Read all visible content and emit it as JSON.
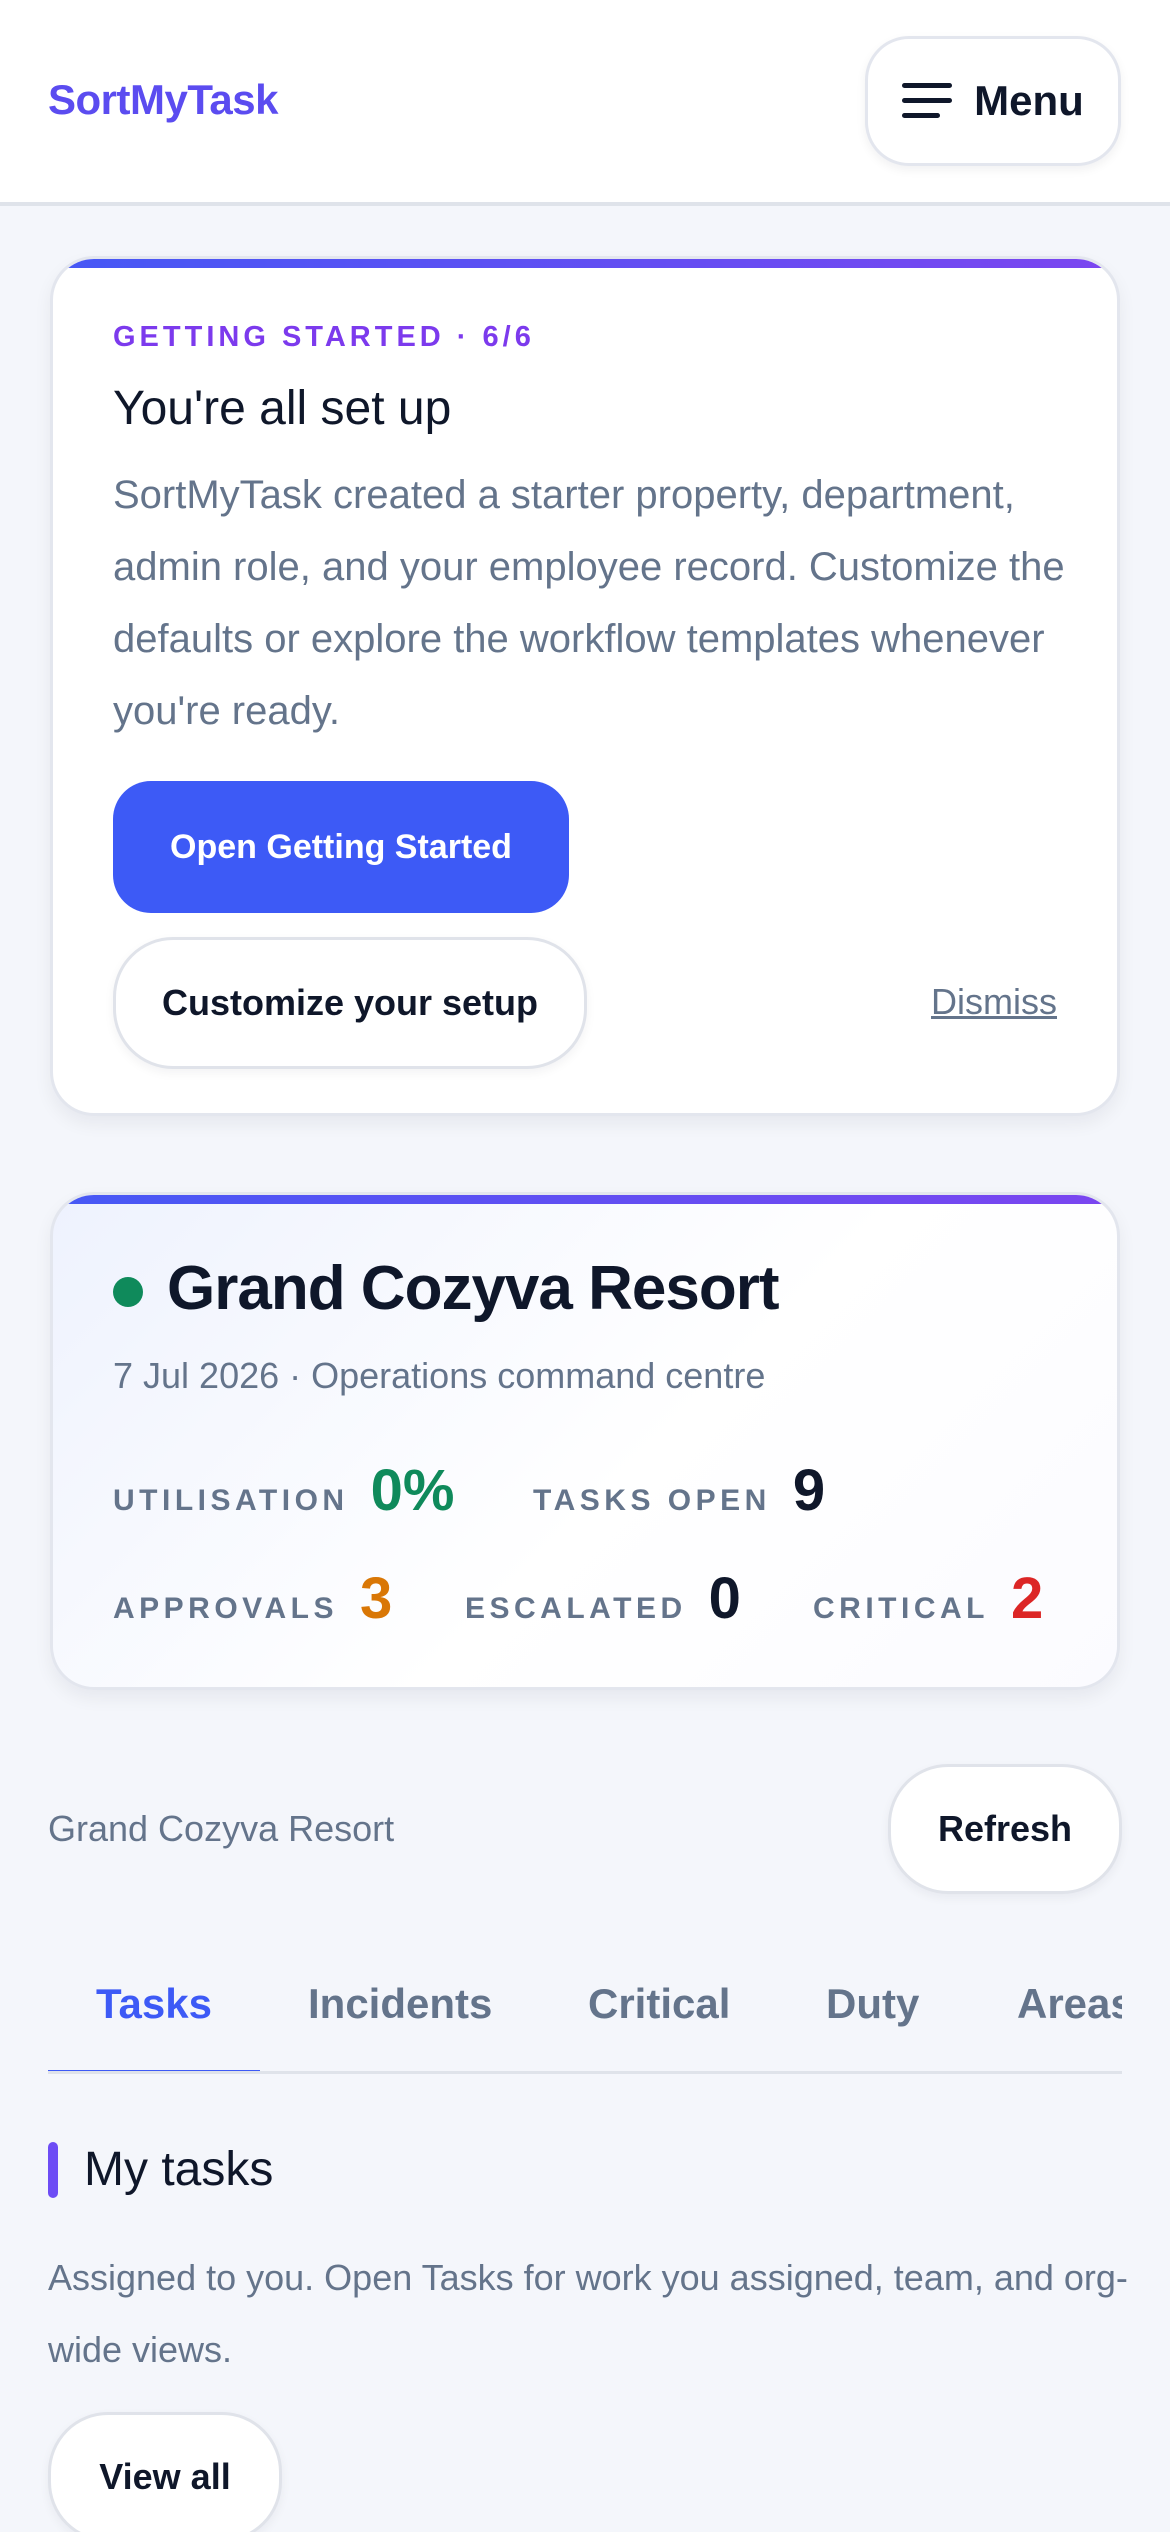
{
  "header": {
    "brand": "SortMyTask",
    "menu_label": "Menu"
  },
  "setup_card": {
    "eyebrow": "GETTING STARTED · 6/6",
    "title": "You're all set up",
    "description": "SortMyTask created a starter property, department, admin role, and your employee record. Customize the defaults or explore the workflow templates whenever you're ready.",
    "primary_button": "Open Getting Started",
    "secondary_button": "Customize your setup",
    "dismiss": "Dismiss"
  },
  "resort_card": {
    "name": "Grand Cozyva Resort",
    "meta": "7 Jul 2026 · Operations command centre",
    "stats": [
      {
        "label": "UTILISATION",
        "value": "0%",
        "color": "#0f8a5b"
      },
      {
        "label": "TASKS OPEN",
        "value": "9",
        "color": "#0f172a"
      },
      {
        "label": "APPROVALS",
        "value": "3",
        "color": "#d97706"
      },
      {
        "label": "ESCALATED",
        "value": "0",
        "color": "#0f172a"
      },
      {
        "label": "CRITICAL",
        "value": "2",
        "color": "#dc2626"
      }
    ]
  },
  "property_row": {
    "name": "Grand Cozyva Resort",
    "refresh_label": "Refresh"
  },
  "tabs": [
    {
      "label": "Tasks",
      "active": true
    },
    {
      "label": "Incidents",
      "active": false
    },
    {
      "label": "Critical",
      "active": false
    },
    {
      "label": "Duty",
      "active": false
    },
    {
      "label": "Areas",
      "active": false
    }
  ],
  "my_tasks": {
    "title": "My tasks",
    "description": "Assigned to you. Open Tasks for work you assigned, team, and org-wide views.",
    "view_all_label": "View all"
  },
  "colors": {
    "accent": "#3d5af6",
    "brand": "#5b4cf0",
    "eyebrow": "#7c3aed"
  }
}
